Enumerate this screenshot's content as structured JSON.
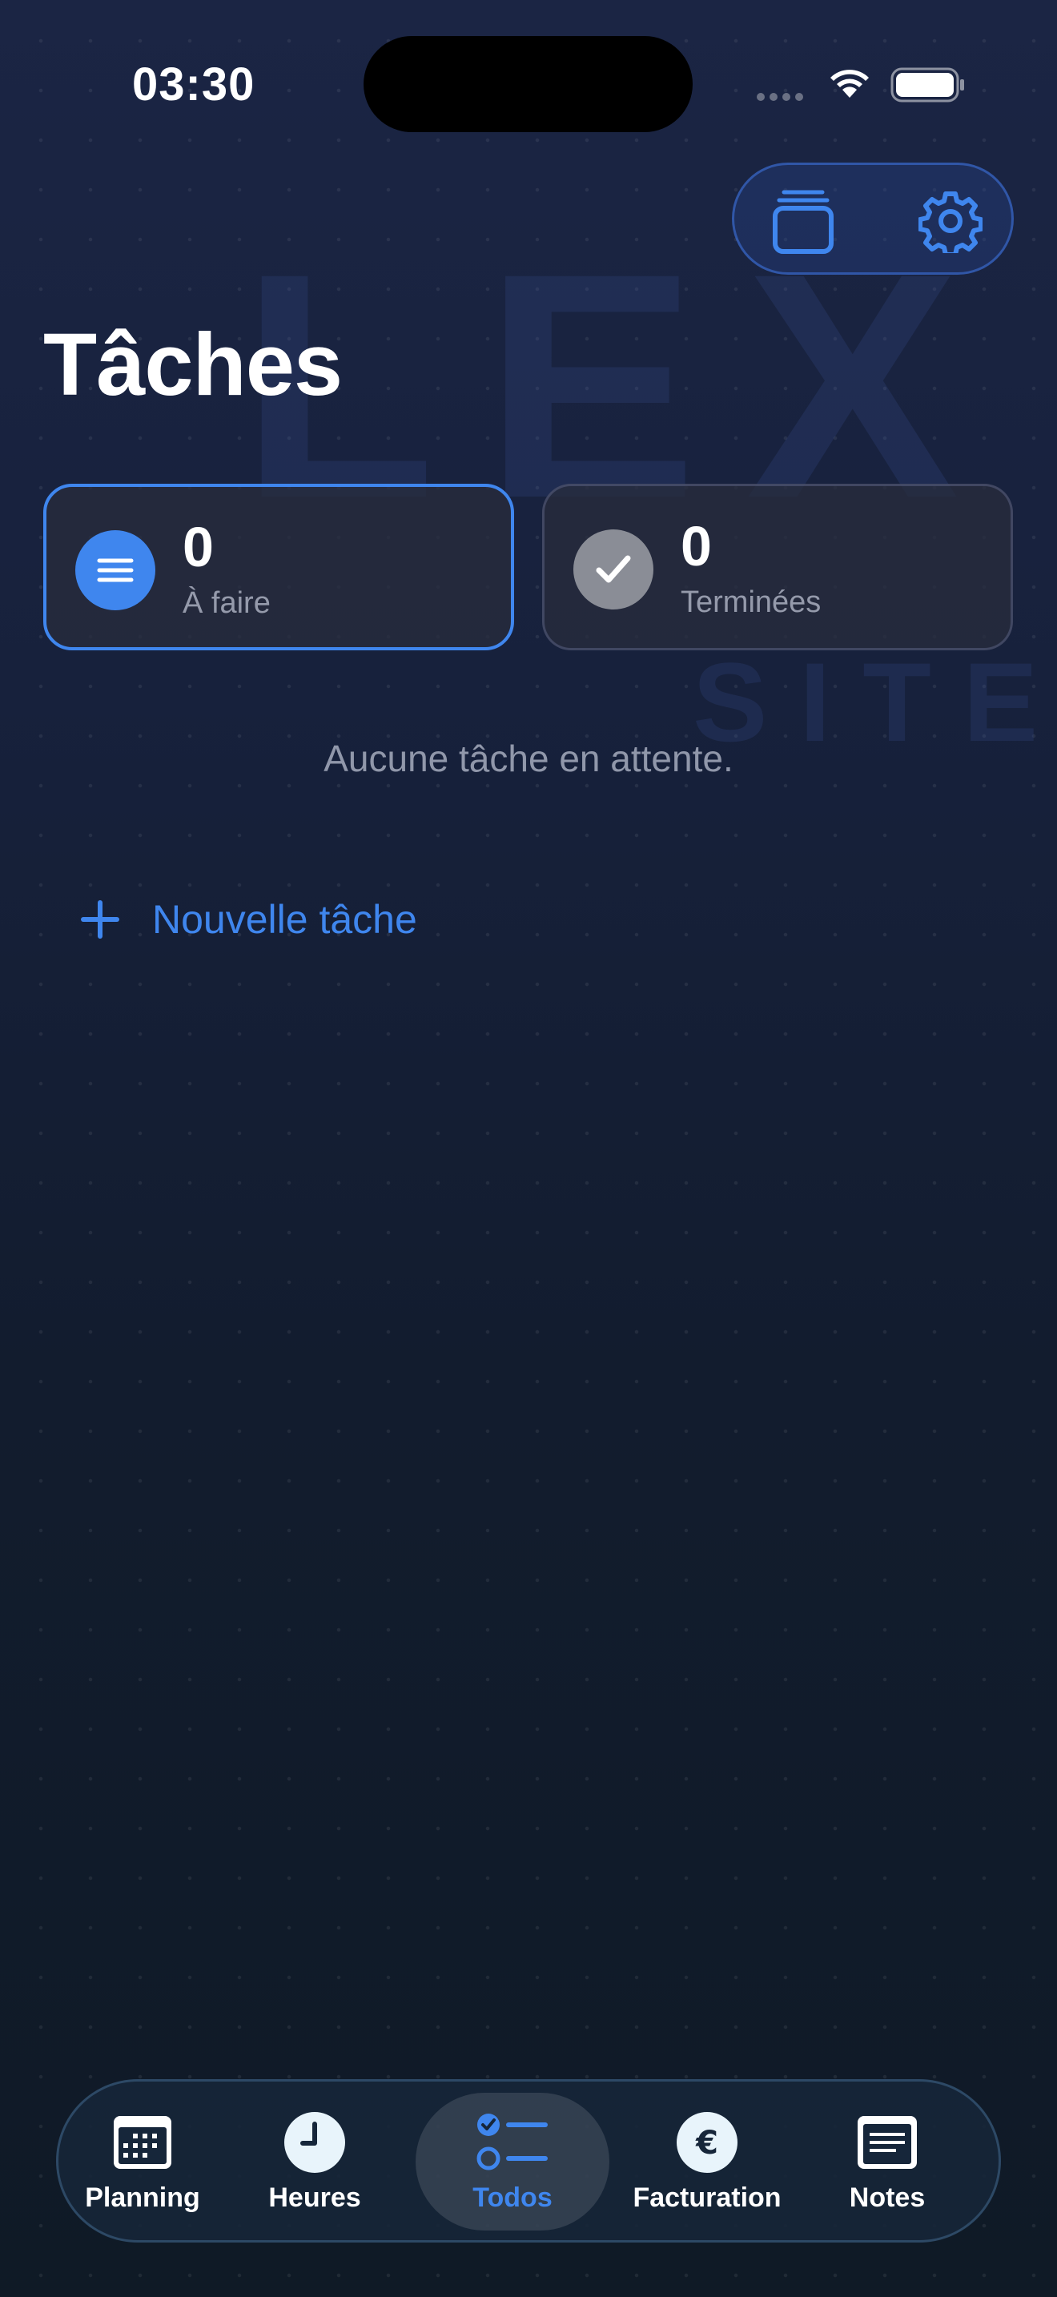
{
  "status_bar": {
    "time": "03:30"
  },
  "watermark": {
    "big_text": "LEX",
    "small_text": "SITE"
  },
  "page": {
    "title": "Tâches"
  },
  "stats": {
    "todo": {
      "count": "0",
      "label": "À faire"
    },
    "done": {
      "count": "0",
      "label": "Terminées"
    }
  },
  "empty_message": "Aucune tâche en attente.",
  "new_task_label": "Nouvelle tâche",
  "tabs": [
    {
      "label": "Planning",
      "icon": "calendar-icon"
    },
    {
      "label": "Heures",
      "icon": "clock-icon"
    },
    {
      "label": "Todos",
      "icon": "checklist-icon",
      "active": true
    },
    {
      "label": "Facturation",
      "icon": "euro-icon"
    },
    {
      "label": "Notes",
      "icon": "notes-icon"
    }
  ],
  "colors": {
    "accent": "#3f86ee",
    "background_top": "#1b2544",
    "background_bottom": "#0f1a26"
  }
}
